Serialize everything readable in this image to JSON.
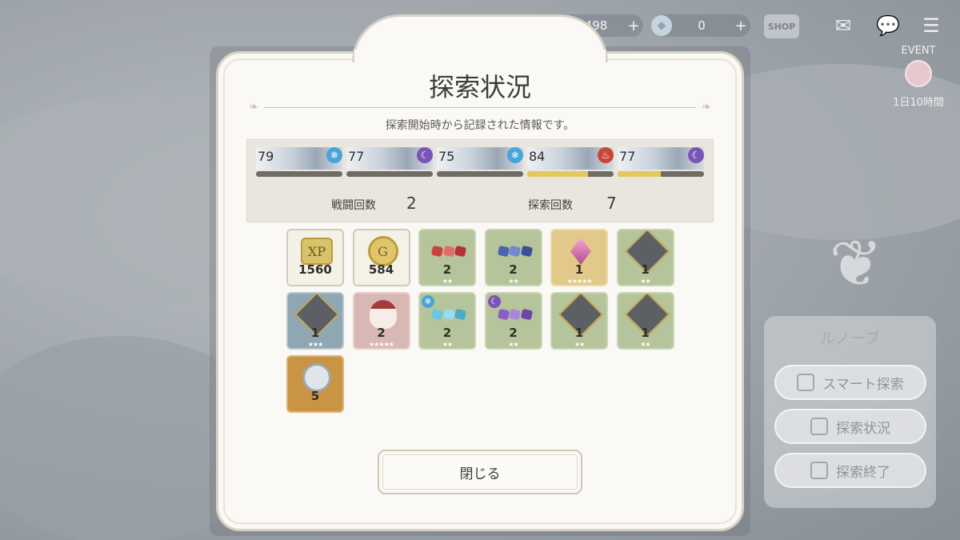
{
  "hud": {
    "currency1": {
      "icon": "coin-icon",
      "value": "498",
      "plus": "+"
    },
    "currency2": {
      "icon": "cube-gem-icon",
      "value": "0",
      "plus": "+"
    },
    "shop_label": "SHOP",
    "event_label": "EVENT",
    "event_time": "1日10時間"
  },
  "side": {
    "name": "ルノーブ",
    "buttons": [
      "スマート探索",
      "探索状況",
      "探索終了"
    ]
  },
  "dialog": {
    "title": "探索状況",
    "subtitle": "探索開始時から記録された情報です。",
    "party": [
      {
        "level": "79",
        "element": "ice",
        "color": "#4aa3d9",
        "fill": 0
      },
      {
        "level": "77",
        "element": "moon",
        "color": "#7a55b8",
        "fill": 0
      },
      {
        "level": "75",
        "element": "ice",
        "color": "#4aa3d9",
        "fill": 0
      },
      {
        "level": "84",
        "element": "fire",
        "color": "#c9473a",
        "fill": 0.7
      },
      {
        "level": "77",
        "element": "moon",
        "color": "#7a55b8",
        "fill": 0.5
      }
    ],
    "battle_label": "戦闘回数",
    "battle_count": "2",
    "explore_label": "探索回数",
    "explore_count": "7",
    "rewards": [
      {
        "name": "xp-item",
        "count": "1560",
        "stars": 0
      },
      {
        "name": "gold-item",
        "count": "584",
        "stars": 0
      },
      {
        "name": "red-gem-item",
        "count": "2",
        "stars": 2
      },
      {
        "name": "blue-gem-item",
        "count": "2",
        "stars": 2
      },
      {
        "name": "pink-crystal-item",
        "count": "1",
        "stars": 5
      },
      {
        "name": "character-medal-item",
        "count": "1",
        "stars": 2
      },
      {
        "name": "character-medal-item",
        "count": "1",
        "stars": 3
      },
      {
        "name": "parfait-item",
        "count": "2",
        "stars": 5
      },
      {
        "name": "ice-gem-item",
        "count": "2",
        "stars": 2
      },
      {
        "name": "moon-gem-item",
        "count": "2",
        "stars": 2
      },
      {
        "name": "character-medal-item",
        "count": "1",
        "stars": 2
      },
      {
        "name": "character-medal-item",
        "count": "1",
        "stars": 2
      },
      {
        "name": "compass-item",
        "count": "5",
        "stars": 0
      }
    ],
    "close_label": "閉じる"
  }
}
